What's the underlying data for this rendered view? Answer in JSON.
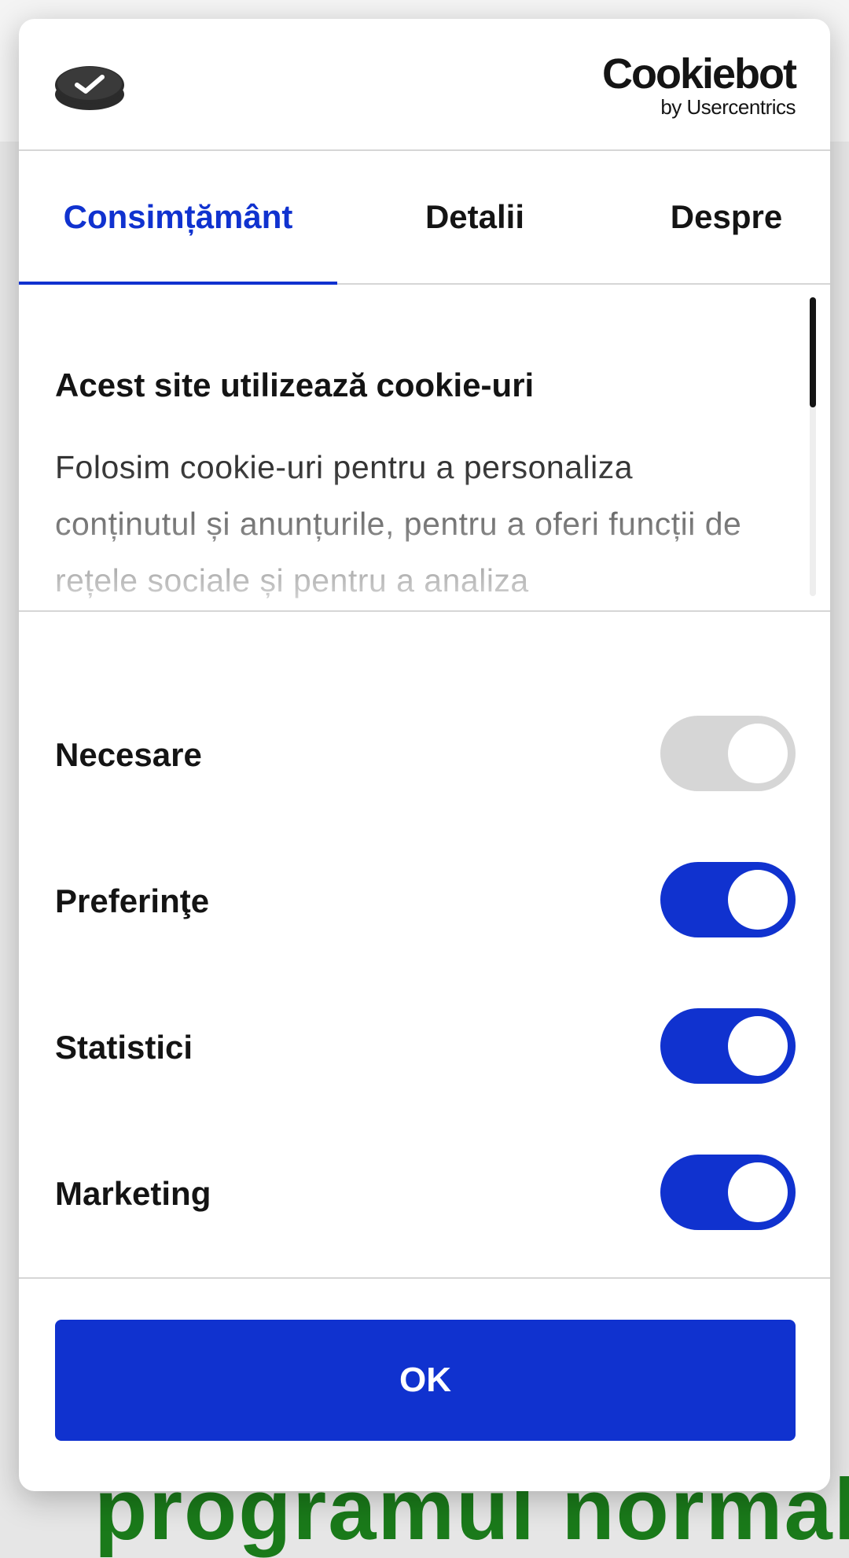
{
  "brand": {
    "name": "Cookiebot",
    "byline": "by Usercentrics"
  },
  "tabs": [
    {
      "label": "Consimțământ",
      "active": true
    },
    {
      "label": "Detalii",
      "active": false
    },
    {
      "label": "Despre",
      "active": false
    }
  ],
  "consent": {
    "title": "Acest site utilizează cookie-uri",
    "body": "Folosim cookie-uri pentru a personaliza conținutul și anunțurile, pentru a oferi funcții de rețele sociale și pentru a analiza"
  },
  "categories": [
    {
      "label": "Necesare",
      "enabled": true,
      "locked": true
    },
    {
      "label": "Preferinţe",
      "enabled": true,
      "locked": false
    },
    {
      "label": "Statistici",
      "enabled": true,
      "locked": false
    },
    {
      "label": "Marketing",
      "enabled": true,
      "locked": false
    }
  ],
  "ok_label": "OK",
  "background_text": "programul normal",
  "colors": {
    "accent": "#1032cf",
    "text": "#141414",
    "divider": "#d6d6d6",
    "toggle_disabled": "#d6d6d6",
    "background_text": "#1a7a1a"
  },
  "icons": {
    "logo": "cookiebot-check-icon"
  }
}
